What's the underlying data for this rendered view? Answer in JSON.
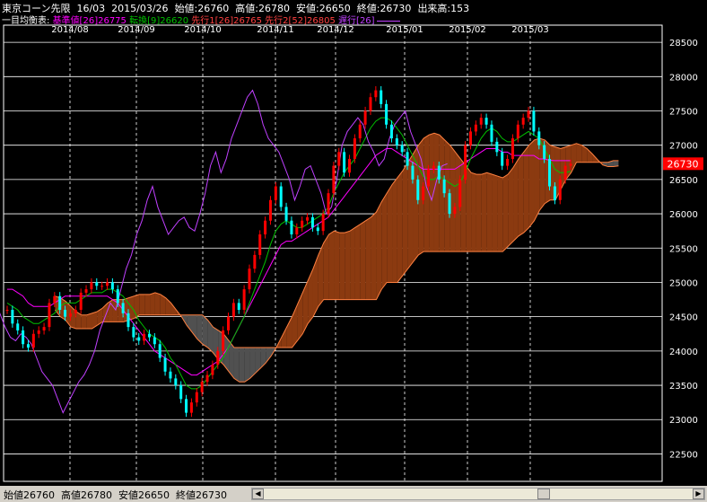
{
  "header": {
    "title": "東京コーン先限",
    "contract": "16/03",
    "date": "2015/03/26",
    "open_label": "始値:",
    "open": "26760",
    "high_label": "高値:",
    "high": "26780",
    "low_label": "安値:",
    "low": "26650",
    "close_label": "終値:",
    "close": "26730",
    "volume_label": "出来高:",
    "volume": "153"
  },
  "legend": {
    "prefix": "一目均衡表:",
    "items": [
      {
        "label": "基準値[26]26775",
        "color": "#ff00ff"
      },
      {
        "label": "転換[9]26620",
        "color": "#00c000"
      },
      {
        "label": "先行1[26]26765",
        "color": "#ff4040"
      },
      {
        "label": "先行2[52]26805",
        "color": "#ff4040"
      },
      {
        "label": "遅行[26]",
        "color": "#c040ff"
      }
    ]
  },
  "footer": {
    "open_label": "始値",
    "open": "26760",
    "high_label": "高値",
    "high": "26780",
    "low_label": "安値",
    "low": "26650",
    "close_label": "終値",
    "close": "26730"
  },
  "colors": {
    "background": "#000000",
    "grid": "#ffffff",
    "up_candle": "#ff0000",
    "down_candle": "#00ffff",
    "kijun": "#ff00ff",
    "tenkan": "#00c000",
    "chikou": "#c040ff",
    "cloud_bull": "#8b3a10",
    "cloud_bear": "#505050",
    "span_line": "#ff8040",
    "price_tag": "#ff0000"
  },
  "chart_data": {
    "type": "candlestick",
    "title": "東京コーン先限",
    "x_labels": [
      "2014/08",
      "2014/09",
      "2014/10",
      "2014/11",
      "2014/12",
      "2015/01",
      "2015/02",
      "2015/03"
    ],
    "y_ticks": [
      22500,
      23000,
      23500,
      24000,
      24500,
      25000,
      25500,
      26000,
      26500,
      27000,
      27500,
      28000,
      28500
    ],
    "ylim": [
      22100,
      28750
    ],
    "last_price": 26730,
    "close": [
      24600,
      24400,
      24300,
      24100,
      24050,
      24250,
      24300,
      24350,
      24700,
      24800,
      24600,
      24500,
      24550,
      24600,
      24850,
      24900,
      25000,
      24950,
      24950,
      25000,
      24900,
      24700,
      24550,
      24350,
      24200,
      24150,
      24250,
      24200,
      24100,
      23900,
      23700,
      23600,
      23500,
      23300,
      23100,
      23250,
      23400,
      23550,
      23650,
      23800,
      24000,
      24300,
      24500,
      24700,
      24600,
      24900,
      25200,
      25400,
      25700,
      25900,
      26200,
      26400,
      26100,
      25900,
      25700,
      25800,
      25900,
      25950,
      25800,
      25750,
      26000,
      26300,
      26700,
      26900,
      26600,
      26800,
      27100,
      27300,
      27500,
      27700,
      27800,
      27600,
      27300,
      27100,
      27000,
      26900,
      26700,
      26500,
      26200,
      26400,
      26650,
      26700,
      26500,
      26300,
      26000,
      26100,
      26500,
      27000,
      27200,
      27300,
      27400,
      27300,
      27050,
      26900,
      26700,
      26800,
      27100,
      27300,
      27400,
      27500,
      27200,
      27000,
      26800,
      26400,
      26200,
      26500,
      26700,
      26730
    ],
    "tenkan": [
      24700,
      24650,
      24600,
      24500,
      24450,
      24400,
      24400,
      24450,
      24500,
      24550,
      24650,
      24700,
      24700,
      24700,
      24750,
      24800,
      24850,
      24850,
      24850,
      24900,
      24900,
      24850,
      24800,
      24700,
      24600,
      24450,
      24350,
      24250,
      24200,
      24150,
      24050,
      23900,
      23800,
      23650,
      23500,
      23450,
      23450,
      23500,
      23600,
      23700,
      23800,
      23900,
      24050,
      24200,
      24350,
      24500,
      24700,
      24900,
      25100,
      25300,
      25550,
      25750,
      25850,
      25900,
      25850,
      25800,
      25800,
      25850,
      25900,
      25950,
      26000,
      26100,
      26300,
      26450,
      26600,
      26700,
      26800,
      26950,
      27100,
      27250,
      27350,
      27400,
      27400,
      27350,
      27250,
      27150,
      27000,
      26850,
      26700,
      26550,
      26500,
      26500,
      26550,
      26500,
      26450,
      26400,
      26450,
      26600,
      26800,
      26950,
      27100,
      27200,
      27250,
      27200,
      27100,
      27050,
      27050,
      27100,
      27150,
      27200,
      27150,
      27100,
      26950,
      26800,
      26650,
      26600,
      26600,
      26620
    ],
    "kijun": [
      24900,
      24900,
      24850,
      24800,
      24700,
      24650,
      24650,
      24650,
      24650,
      24700,
      24750,
      24800,
      24800,
      24800,
      24800,
      24800,
      24800,
      24800,
      24800,
      24800,
      24750,
      24700,
      24600,
      24500,
      24400,
      24300,
      24200,
      24100,
      24000,
      23950,
      23900,
      23850,
      23800,
      23750,
      23700,
      23650,
      23650,
      23700,
      23750,
      23800,
      23850,
      23950,
      24050,
      24200,
      24350,
      24500,
      24650,
      24800,
      24950,
      25100,
      25250,
      25400,
      25550,
      25600,
      25600,
      25650,
      25700,
      25750,
      25800,
      25850,
      25900,
      25950,
      26050,
      26150,
      26250,
      26350,
      26450,
      26550,
      26650,
      26750,
      26850,
      26900,
      26950,
      26950,
      26900,
      26850,
      26800,
      26750,
      26700,
      26650,
      26650,
      26650,
      26650,
      26650,
      26650,
      26650,
      26700,
      26750,
      26800,
      26850,
      26900,
      26950,
      26950,
      26950,
      26900,
      26900,
      26850,
      26850,
      26850,
      26850,
      26850,
      26800,
      26800,
      26780,
      26775,
      26775,
      26775,
      26775
    ]
  }
}
